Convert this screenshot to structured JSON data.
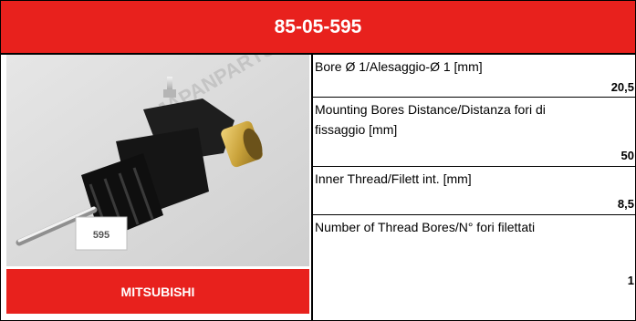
{
  "part_number": "85-05-595",
  "brand": "MITSUBISHI",
  "photo": {
    "part_label": "595",
    "watermark": "JAPANPARTS"
  },
  "specs": [
    {
      "label": "Bore Ø 1/Alesaggio-Ø 1 [mm]",
      "value": "20,5"
    },
    {
      "label": "Mounting Bores Distance/Distanza fori di fissaggio [mm]",
      "value": "50"
    },
    {
      "label": "Inner Thread/Filett int. [mm]",
      "value": "8,5"
    },
    {
      "label": "Number of Thread Bores/N° fori filettati",
      "value": "1"
    }
  ],
  "colors": {
    "accent_red": "#e8211d",
    "border": "#000000",
    "photo_background": "#dcdcdc"
  }
}
